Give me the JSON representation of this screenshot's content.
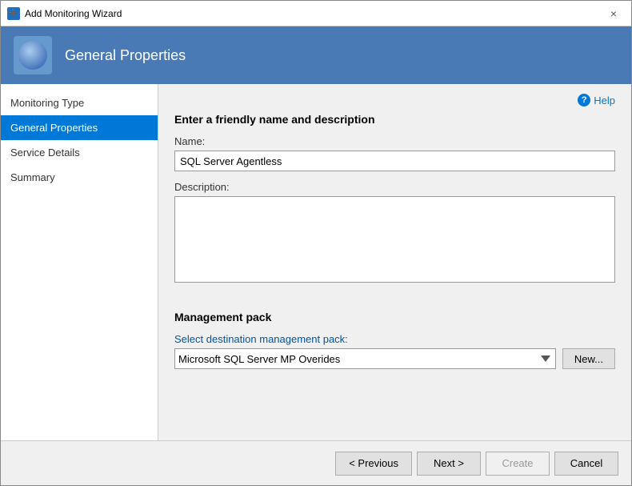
{
  "window": {
    "title": "Add Monitoring Wizard",
    "close_label": "×"
  },
  "header": {
    "title": "General Properties"
  },
  "sidebar": {
    "items": [
      {
        "id": "monitoring-type",
        "label": "Monitoring Type",
        "active": false
      },
      {
        "id": "general-properties",
        "label": "General Properties",
        "active": true
      },
      {
        "id": "service-details",
        "label": "Service Details",
        "active": false
      },
      {
        "id": "summary",
        "label": "Summary",
        "active": false
      }
    ]
  },
  "help": {
    "label": "Help"
  },
  "form": {
    "section_title": "Enter a friendly name and description",
    "name_label": "Name:",
    "name_value": "SQL Server Agentless",
    "description_label": "Description:",
    "description_value": "",
    "mgmt_pack_title": "Management pack",
    "mgmt_pack_select_label": "Select destination management pack:",
    "mgmt_pack_option": "Microsoft SQL Server MP Overides",
    "new_button_label": "New..."
  },
  "footer": {
    "previous_label": "< Previous",
    "next_label": "Next >",
    "create_label": "Create",
    "cancel_label": "Cancel"
  }
}
